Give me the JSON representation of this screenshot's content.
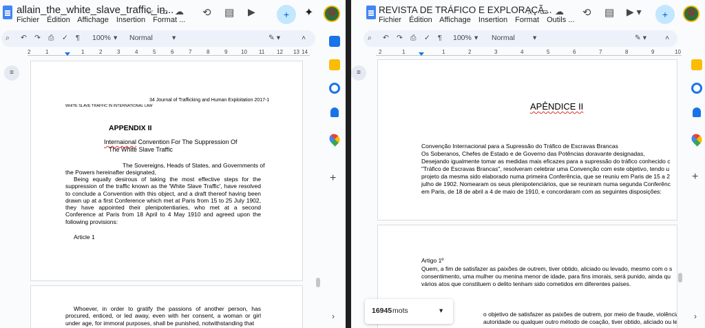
{
  "left": {
    "title": "allain_the_white_slave_traffic_in...",
    "menus": [
      "Fichier",
      "Édition",
      "Affichage",
      "Insertion",
      "Format ..."
    ],
    "zoom": "100%",
    "style": "Normal",
    "ruler_ticks": [
      "2",
      "1",
      "1",
      "2",
      "3",
      "4",
      "5",
      "6",
      "7",
      "8",
      "9",
      "10",
      "11",
      "12",
      "13",
      "14"
    ],
    "page1": {
      "header_right": "34 Journal of Trafficking and Human Exploitation 2017-1",
      "header_left": "WHITE SLAVE TRAFFIC IN INTERNATIONAL LAW",
      "appendix": "APPENDIX II",
      "conv_word": "Internaional",
      "conv_rest": " Convention For The Suppression Of",
      "conv_line2": "The White Slave Traffic",
      "para1_line1": "The Sovereigns, Heads of States, and Governments of",
      "para1_line2": "the Powers hereinafter designated,",
      "para2": "Being equally desirous of taking the most effective steps for the suppression of the traffic known as the 'White Slave Traffic', have resolved to conclude a Convention with this object, and a draft thereof having been drawn up at a first Conference which met at Paris from 15 to 25 July 1902, they have appointed their plenipotentiaries, who met at a second Conference at Paris from 18 April to 4 May 1910 and agreed upon the following provisions:",
      "article": "Article 1"
    },
    "page2": {
      "text": "Whoever, in order to gratify the passions of another person, has procured, enticed, or led away, even with her consent, a woman or girl under age, for immoral purposes, shall be punished, notwithstanding that"
    }
  },
  "right": {
    "title": "REVISTA DE TRÁFICO E EXPLORAÇÃ...",
    "menus": [
      "Fichier",
      "Édition",
      "Affichage",
      "Insertion",
      "Format",
      "Outils ..."
    ],
    "zoom": "100%",
    "style": "Normal",
    "ruler_ticks": [
      "2",
      "1",
      "1",
      "2",
      "3",
      "4",
      "5",
      "6",
      "7",
      "8",
      "9",
      "10"
    ],
    "page1": {
      "heading": "APÊNDICE II",
      "lines": [
        "Convenção Internacional para a Supressão do Tráfico de Escravas Brancas",
        "Os Soberanos, Chefes de Estado e de Governo das Potências doravante designadas,",
        "Desejando igualmente tomar as medidas mais eficazes para a supressão do tráfico conhecido c",
        "\"Tráfico de Escravas Brancas\", resolveram celebrar uma Convenção com este objetivo, tendo u",
        "projeto da mesma sido elaborado numa primeira Conferência, que se reuniu em Paris de 15 a 2",
        "julho de 1902. Nomearam os seus plenipotenciários, que se reuniram numa segunda Conferênc",
        "em Paris, de 18 de abril a 4 de maio de 1910, e concordaram com as seguintes disposições:"
      ]
    },
    "page2": {
      "lines": [
        "Artigo 1º",
        "Quem, a fim de satisfazer as paixões de outrem, tiver obtido, aliciado ou levado, mesmo com o s",
        "consentimento, uma mulher ou menina menor de idade, para fins imorais, será punido, ainda qu",
        "vários atos que constituem o delito tenham sido cometidos em diferentes países.",
        "",
        "o objetivo de satisfazer as paixões de outrem, por meio de fraude, violência, ameaç",
        "autoridade ou qualquer outro método de coação, tiver obtido, aliciado ou levado, u"
      ]
    },
    "wordcount": {
      "count": "16945",
      "unit": "mots"
    }
  },
  "colors": {
    "accent": "#0b57d0",
    "share": "#c2e7ff",
    "toolbar": "#edf2fa"
  },
  "icons": [
    "search-icon",
    "undo-icon",
    "redo-icon",
    "print-icon",
    "spellcheck-icon",
    "paint-format-icon",
    "edit-icon",
    "history-icon",
    "comment-icon",
    "meet-icon",
    "share-icon",
    "gemini-icon",
    "keep-icon",
    "tasks-icon",
    "contacts-icon",
    "maps-icon",
    "add-icon"
  ]
}
